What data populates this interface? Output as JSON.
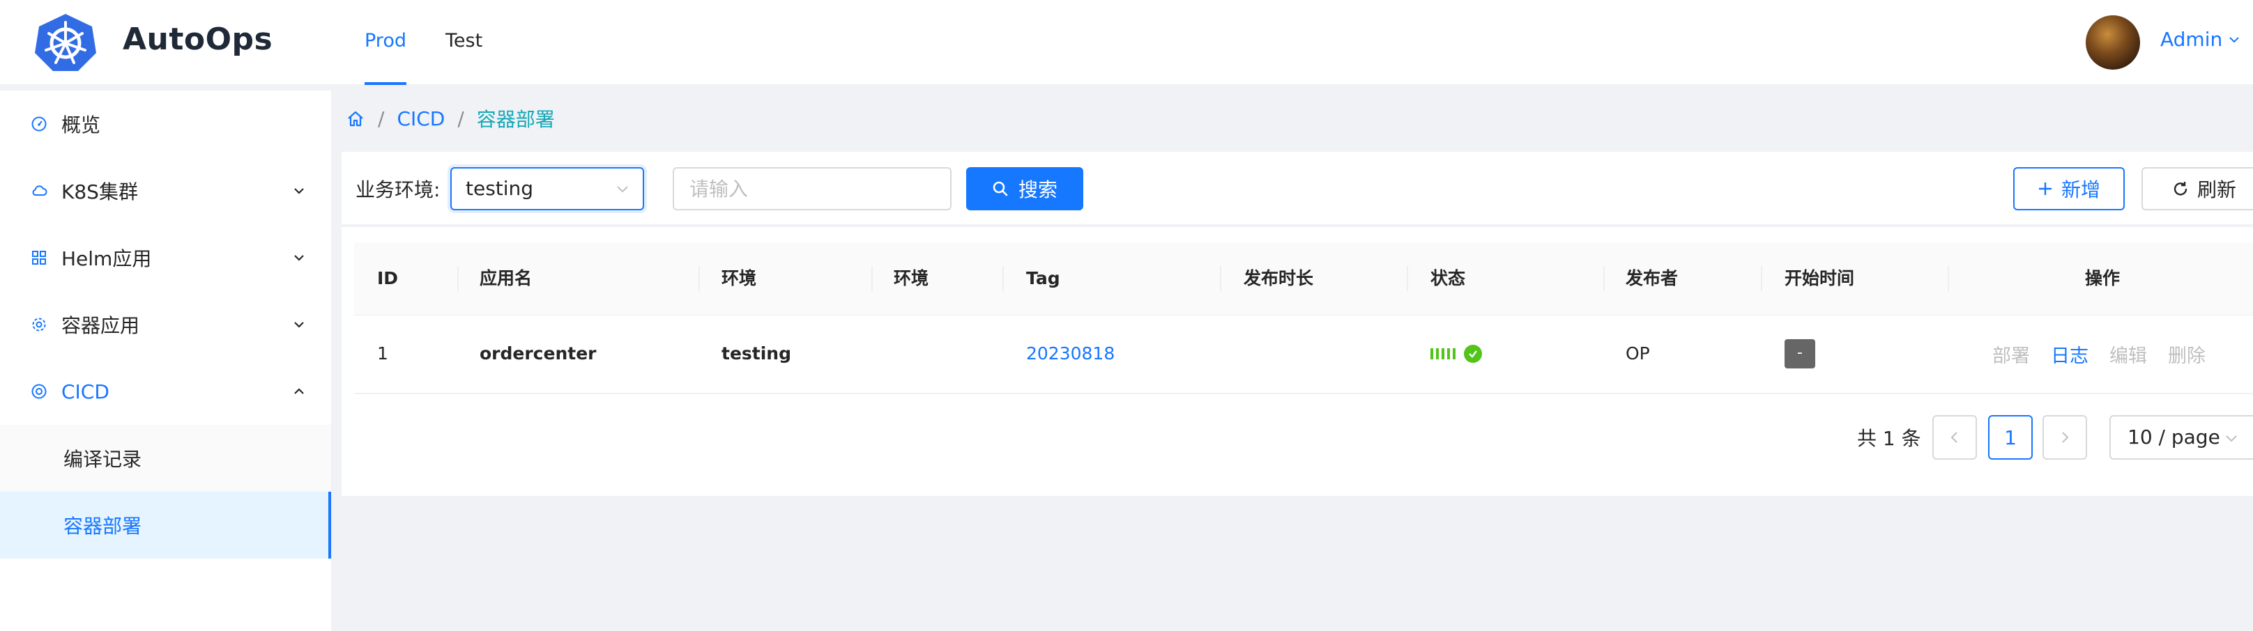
{
  "header": {
    "brand": "AutoOps",
    "tabs": [
      {
        "label": "Prod",
        "active": true
      },
      {
        "label": "Test",
        "active": false
      }
    ],
    "user": {
      "name": "Admin"
    }
  },
  "sidebar": {
    "items": [
      {
        "label": "概览",
        "icon": "dashboard-icon"
      },
      {
        "label": "K8S集群",
        "icon": "cloud-icon"
      },
      {
        "label": "Helm应用",
        "icon": "apps-icon"
      },
      {
        "label": "容器应用",
        "icon": "settings-icon"
      },
      {
        "label": "CICD",
        "icon": "cicd-icon",
        "open": true
      }
    ],
    "submenu": [
      {
        "label": "编译记录"
      },
      {
        "label": "容器部署",
        "selected": true
      }
    ]
  },
  "breadcrumb": [
    "CICD",
    "容器部署"
  ],
  "search": {
    "env_label": "业务环境:",
    "env_value": "testing",
    "placeholder": "请输入",
    "search_label": "搜索",
    "add_label": "新增",
    "refresh_label": "刷新"
  },
  "table": {
    "columns": [
      "ID",
      "应用名",
      "环境",
      "环境",
      "Tag",
      "发布时长",
      "状态",
      "发布者",
      "开始时间",
      "操作"
    ],
    "rows": [
      {
        "id": "1",
        "app": "ordercenter",
        "env": "testing",
        "env2": "",
        "tag": "20230818",
        "duration": "",
        "status": "success",
        "publisher": "OP",
        "start_time": "-",
        "actions": [
          "部署",
          "日志",
          "编辑",
          "删除"
        ]
      }
    ]
  },
  "pagination": {
    "total_text": "共 1 条",
    "current_page": "1",
    "page_size": "10 / page"
  },
  "colors": {
    "primary": "#1677ff",
    "success": "#52c41a",
    "breadcrumb_current": "#13a8b8",
    "disabled": "#bfbfbf"
  }
}
